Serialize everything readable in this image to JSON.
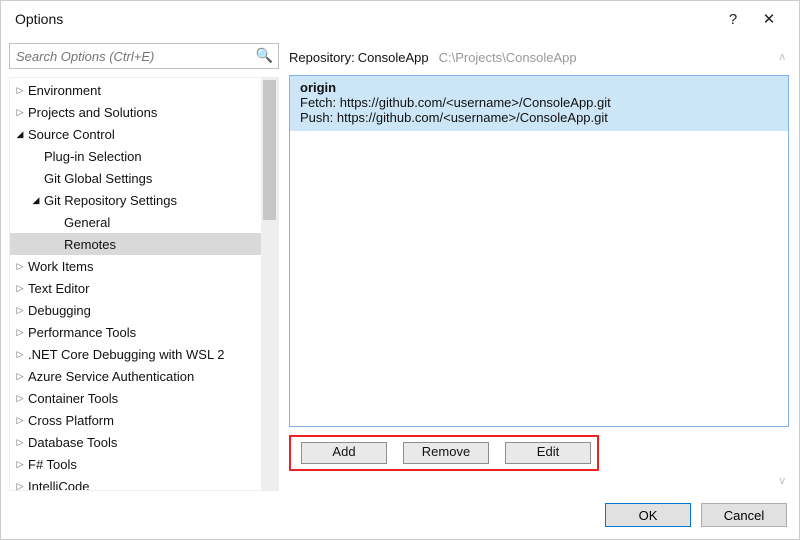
{
  "window": {
    "title": "Options",
    "help_glyph": "?",
    "close_glyph": "✕"
  },
  "search": {
    "placeholder": "Search Options (Ctrl+E)",
    "icon_glyph": "🔍"
  },
  "tree": [
    {
      "label": "Environment",
      "depth": 0,
      "expanded": false,
      "hasChildren": true
    },
    {
      "label": "Projects and Solutions",
      "depth": 0,
      "expanded": false,
      "hasChildren": true
    },
    {
      "label": "Source Control",
      "depth": 0,
      "expanded": true,
      "hasChildren": true
    },
    {
      "label": "Plug-in Selection",
      "depth": 1,
      "expanded": false,
      "hasChildren": false
    },
    {
      "label": "Git Global Settings",
      "depth": 1,
      "expanded": false,
      "hasChildren": false
    },
    {
      "label": "Git Repository Settings",
      "depth": 1,
      "expanded": true,
      "hasChildren": true
    },
    {
      "label": "General",
      "depth": 2,
      "expanded": false,
      "hasChildren": false
    },
    {
      "label": "Remotes",
      "depth": 2,
      "expanded": false,
      "hasChildren": false,
      "selected": true
    },
    {
      "label": "Work Items",
      "depth": 0,
      "expanded": false,
      "hasChildren": true
    },
    {
      "label": "Text Editor",
      "depth": 0,
      "expanded": false,
      "hasChildren": true
    },
    {
      "label": "Debugging",
      "depth": 0,
      "expanded": false,
      "hasChildren": true
    },
    {
      "label": "Performance Tools",
      "depth": 0,
      "expanded": false,
      "hasChildren": true
    },
    {
      "label": ".NET Core Debugging with WSL 2",
      "depth": 0,
      "expanded": false,
      "hasChildren": true
    },
    {
      "label": "Azure Service Authentication",
      "depth": 0,
      "expanded": false,
      "hasChildren": true
    },
    {
      "label": "Container Tools",
      "depth": 0,
      "expanded": false,
      "hasChildren": true
    },
    {
      "label": "Cross Platform",
      "depth": 0,
      "expanded": false,
      "hasChildren": true
    },
    {
      "label": "Database Tools",
      "depth": 0,
      "expanded": false,
      "hasChildren": true
    },
    {
      "label": "F# Tools",
      "depth": 0,
      "expanded": false,
      "hasChildren": true
    },
    {
      "label": "IntelliCode",
      "depth": 0,
      "expanded": false,
      "hasChildren": true
    }
  ],
  "repo": {
    "label": "Repository:",
    "name": "ConsoleApp",
    "path": "C:\\Projects\\ConsoleApp"
  },
  "remote": {
    "name": "origin",
    "fetch_label": "Fetch:",
    "fetch_url": "https://github.com/<username>/ConsoleApp.git",
    "push_label": "Push:",
    "push_url": "https://github.com/<username>/ConsoleApp.git"
  },
  "buttons": {
    "add": "Add",
    "remove": "Remove",
    "edit": "Edit",
    "ok": "OK",
    "cancel": "Cancel"
  },
  "glyphs": {
    "arrow_collapsed": "▷",
    "arrow_expanded": "◢",
    "chev_up": "ʌ",
    "chev_down": "v"
  }
}
